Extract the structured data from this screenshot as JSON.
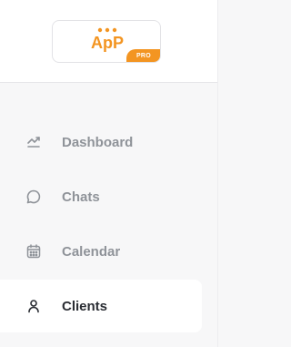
{
  "logo": {
    "text": "ApP",
    "badge": "PRO",
    "brand_color": "#f39522"
  },
  "nav": {
    "items": [
      {
        "label": "Dashboard",
        "icon": "trend-chart-icon",
        "active": false
      },
      {
        "label": "Chats",
        "icon": "chat-bubble-icon",
        "active": false
      },
      {
        "label": "Calendar",
        "icon": "calendar-icon",
        "active": false
      },
      {
        "label": "Clients",
        "icon": "user-icon",
        "active": true
      }
    ]
  },
  "colors": {
    "active_text": "#2a2d33",
    "inactive_text": "#8f9399",
    "sidebar_bg": "#f7f7f8"
  }
}
